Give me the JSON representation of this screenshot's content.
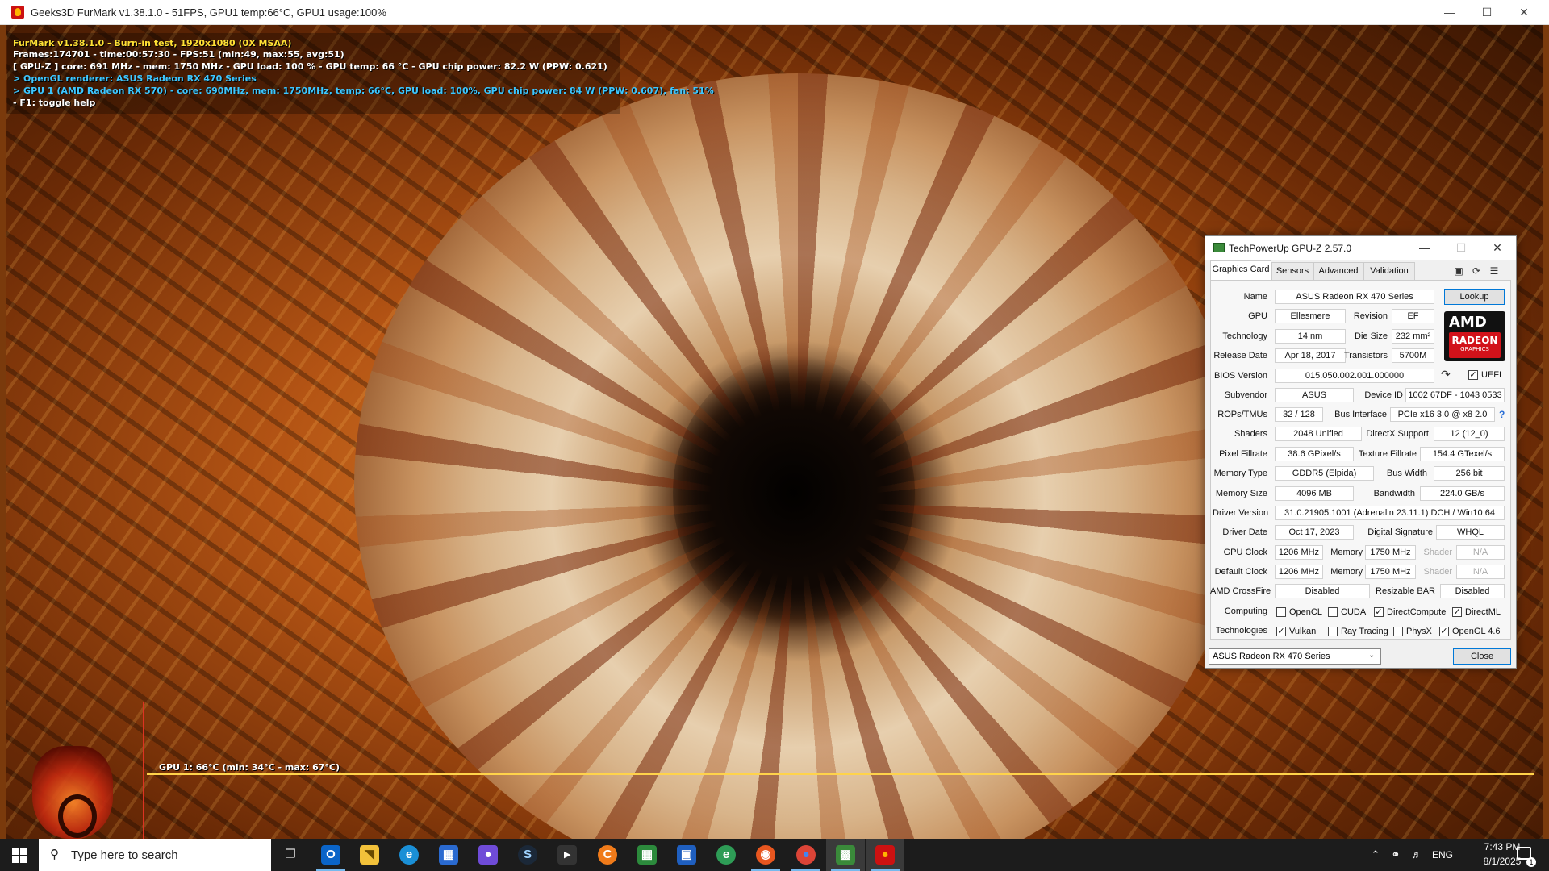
{
  "furmark": {
    "window_title": "Geeks3D FurMark v1.38.1.0 - 51FPS, GPU1 temp:66°C, GPU1 usage:100%",
    "osd": {
      "line1": "FurMark v1.38.1.0 - Burn-in test, 1920x1080 (0X MSAA)",
      "line2": "Frames:174701 - time:00:57:30 - FPS:51 (min:49, max:55, avg:51)",
      "line3": "[ GPU-Z ] core: 691 MHz - mem: 1750 MHz - GPU load: 100 % - GPU temp: 66 °C - GPU chip power: 82.2 W (PPW: 0.621)",
      "line4": "> OpenGL renderer: ASUS Radeon RX 470 Series",
      "line5": "> GPU 1 (AMD Radeon RX 570) - core: 690MHz, mem: 1750MHz, temp: 66°C, GPU load: 100%, GPU chip power: 84 W (PPW: 0.607), fan: 51%",
      "line6": "- F1: toggle help"
    },
    "graph_label": "GPU 1: 66°C (min: 34°C - max: 67°C)",
    "colors": {
      "osd_yellow": "#ffe135",
      "osd_cyan": "#3ec7ff",
      "graph_line": "#ffd34a"
    }
  },
  "gpuz": {
    "title": "TechPowerUp GPU-Z 2.57.0",
    "tabs": [
      "Graphics Card",
      "Sensors",
      "Advanced",
      "Validation"
    ],
    "lookup_label": "Lookup",
    "close_label": "Close",
    "rows": {
      "name": {
        "label": "Name",
        "value": "ASUS Radeon RX 470 Series"
      },
      "gpu": {
        "label": "GPU",
        "value": "Ellesmere"
      },
      "revision": {
        "label": "Revision",
        "value": "EF"
      },
      "technology": {
        "label": "Technology",
        "value": "14 nm"
      },
      "die_size": {
        "label": "Die Size",
        "value": "232 mm²"
      },
      "release_date": {
        "label": "Release Date",
        "value": "Apr 18, 2017"
      },
      "transistors": {
        "label": "Transistors",
        "value": "5700M"
      },
      "bios_version": {
        "label": "BIOS Version",
        "value": "015.050.002.001.000000"
      },
      "uefi": {
        "label": "UEFI",
        "checked": true
      },
      "subvendor": {
        "label": "Subvendor",
        "value": "ASUS"
      },
      "device_id": {
        "label": "Device ID",
        "value": "1002 67DF - 1043 0533"
      },
      "rops_tmus": {
        "label": "ROPs/TMUs",
        "value": "32 / 128"
      },
      "bus_interface": {
        "label": "Bus Interface",
        "value": "PCIe x16 3.0 @ x8 2.0"
      },
      "shaders": {
        "label": "Shaders",
        "value": "2048 Unified"
      },
      "directx": {
        "label": "DirectX Support",
        "value": "12 (12_0)"
      },
      "pixel_fillrate": {
        "label": "Pixel Fillrate",
        "value": "38.6 GPixel/s"
      },
      "texture_fillrate": {
        "label": "Texture Fillrate",
        "value": "154.4 GTexel/s"
      },
      "memory_type": {
        "label": "Memory Type",
        "value": "GDDR5 (Elpida)"
      },
      "bus_width": {
        "label": "Bus Width",
        "value": "256 bit"
      },
      "memory_size": {
        "label": "Memory Size",
        "value": "4096 MB"
      },
      "bandwidth": {
        "label": "Bandwidth",
        "value": "224.0 GB/s"
      },
      "driver_version": {
        "label": "Driver Version",
        "value": "31.0.21905.1001 (Adrenalin 23.11.1) DCH / Win10 64"
      },
      "driver_date": {
        "label": "Driver Date",
        "value": "Oct 17, 2023"
      },
      "digital_signature": {
        "label": "Digital Signature",
        "value": "WHQL"
      },
      "gpu_clock": {
        "label": "GPU Clock",
        "value": "1206 MHz",
        "memory_label": "Memory",
        "memory_value": "1750 MHz",
        "shader_label": "Shader",
        "shader_value": "N/A"
      },
      "default_clock": {
        "label": "Default Clock",
        "value": "1206 MHz",
        "memory_label": "Memory",
        "memory_value": "1750 MHz",
        "shader_label": "Shader",
        "shader_value": "N/A"
      },
      "crossfire": {
        "label": "AMD CrossFire",
        "value": "Disabled"
      },
      "resizable_bar": {
        "label": "Resizable BAR",
        "value": "Disabled"
      }
    },
    "computing": {
      "label": "Computing",
      "items": [
        {
          "name": "OpenCL",
          "checked": false
        },
        {
          "name": "CUDA",
          "checked": false
        },
        {
          "name": "DirectCompute",
          "checked": true
        },
        {
          "name": "DirectML",
          "checked": true
        }
      ]
    },
    "technologies": {
      "label": "Technologies",
      "items": [
        {
          "name": "Vulkan",
          "checked": true
        },
        {
          "name": "Ray Tracing",
          "checked": false
        },
        {
          "name": "PhysX",
          "checked": false
        },
        {
          "name": "OpenGL 4.6",
          "checked": true
        }
      ]
    },
    "gpu_select_value": "ASUS Radeon RX 470 Series",
    "logo": {
      "brand": "AMD",
      "line1": "RADEON",
      "line2": "GRAPHICS"
    },
    "colors": {
      "radeon_red": "#d2121a",
      "button_focus": "#0078d7"
    }
  },
  "taskbar": {
    "search_placeholder": "Type here to search",
    "apps": [
      {
        "name": "task-view",
        "icon": "task-view-icon"
      },
      {
        "name": "outlook",
        "icon": "outlook-icon"
      },
      {
        "name": "file-explorer",
        "icon": "folder-icon"
      },
      {
        "name": "edge",
        "icon": "edge-icon"
      },
      {
        "name": "store",
        "icon": "store-icon"
      },
      {
        "name": "xbox",
        "icon": "gamepad-icon"
      },
      {
        "name": "steam",
        "icon": "steam-icon"
      },
      {
        "name": "clapper",
        "icon": "clapperboard-icon"
      },
      {
        "name": "ccleaner",
        "icon": "ccleaner-icon"
      },
      {
        "name": "spreadsheet",
        "icon": "spreadsheet-icon"
      },
      {
        "name": "window-app",
        "icon": "window-icon"
      },
      {
        "name": "edge-dev",
        "icon": "edge-dev-icon"
      },
      {
        "name": "firefox",
        "icon": "firefox-icon"
      },
      {
        "name": "chrome",
        "icon": "chrome-icon"
      },
      {
        "name": "gpu-z",
        "icon": "gpuz-icon"
      },
      {
        "name": "furmark",
        "icon": "furmark-icon"
      }
    ],
    "tray": {
      "language": "ENG",
      "time": "7:43 PM",
      "date": "8/1/2025",
      "notification_count": "1"
    }
  }
}
